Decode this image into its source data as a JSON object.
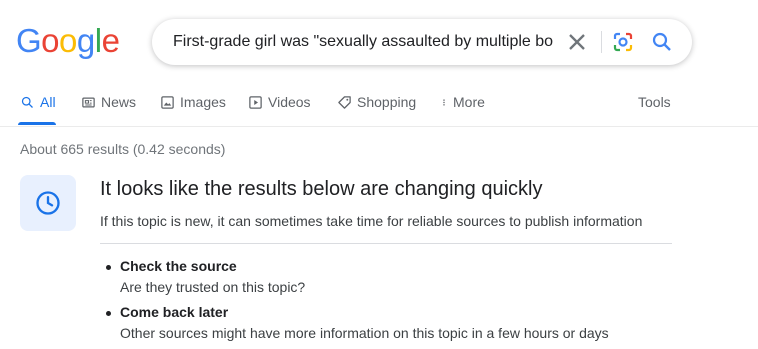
{
  "logo": {
    "letters": [
      "G",
      "o",
      "o",
      "g",
      "l",
      "e"
    ],
    "colors": [
      "#4285f4",
      "#ea4335",
      "#fbbc05",
      "#4285f4",
      "#34a853",
      "#ea4335"
    ]
  },
  "search": {
    "query": "First-grade girl was \"sexually assaulted by multiple boys\"",
    "icons": [
      "close-icon",
      "google-lens-icon",
      "search-icon"
    ]
  },
  "tabs": [
    {
      "label": "All",
      "icon": "search-icon",
      "active": true
    },
    {
      "label": "News",
      "icon": "newspaper-icon"
    },
    {
      "label": "Images",
      "icon": "image-icon"
    },
    {
      "label": "Videos",
      "icon": "play-icon"
    },
    {
      "label": "Shopping",
      "icon": "tag-icon"
    },
    {
      "label": "More",
      "icon": "more-vertical-icon"
    },
    {
      "label": "Tools"
    }
  ],
  "stats": "About 665 results (0.42 seconds)",
  "notice": {
    "icon": "clock-icon",
    "heading": "It looks like the results below are changing quickly",
    "subtitle": "If this topic is new, it can sometimes take time for reliable sources to publish information",
    "items": [
      {
        "title": "Check the source",
        "text": "Are they trusted on this topic?"
      },
      {
        "title": "Come back later",
        "text": "Other sources might have more information on this topic in a few hours or days"
      }
    ]
  },
  "colors": {
    "accent": "#1a73e8",
    "muted": "#5f6368",
    "notice_bg": "#e8f0fe"
  }
}
